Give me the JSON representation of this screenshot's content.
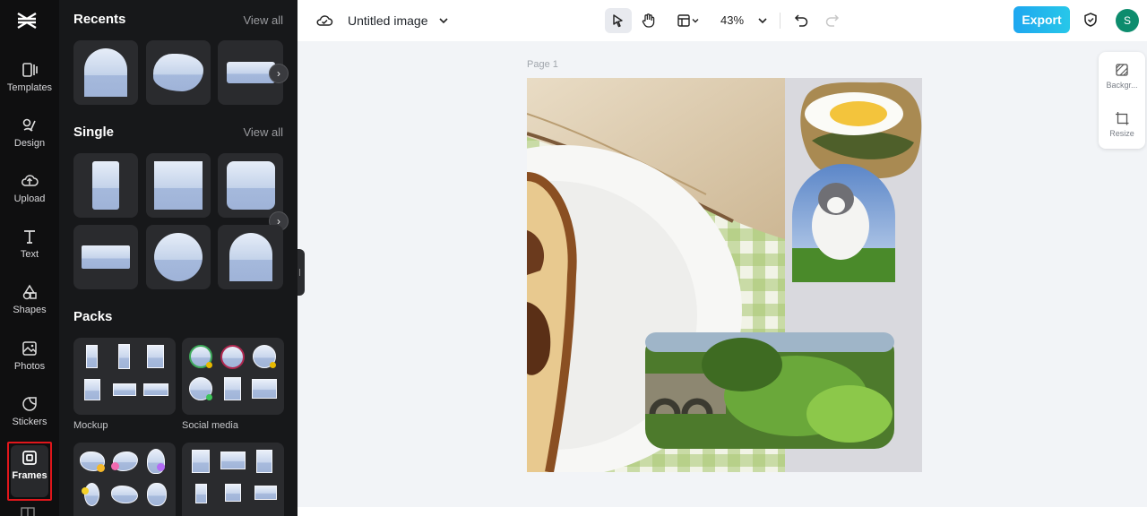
{
  "rail": {
    "items": [
      {
        "label": "Templates"
      },
      {
        "label": "Design"
      },
      {
        "label": "Upload"
      },
      {
        "label": "Text"
      },
      {
        "label": "Shapes"
      },
      {
        "label": "Photos"
      },
      {
        "label": "Stickers"
      },
      {
        "label": "Frames"
      }
    ],
    "active": "Frames"
  },
  "panel": {
    "recents_title": "Recents",
    "recents_view_all": "View all",
    "single_title": "Single",
    "single_view_all": "View all",
    "packs_title": "Packs",
    "packs": [
      {
        "label": "Mockup"
      },
      {
        "label": "Social media"
      }
    ]
  },
  "topbar": {
    "title": "Untitled image",
    "zoom": "43%",
    "export_label": "Export",
    "avatar_initial": "S"
  },
  "canvas": {
    "page_label": "Page 1"
  },
  "float_panel": {
    "background_label": "Backgr...",
    "resize_label": "Resize"
  },
  "colors": {
    "accent": "#1ea7f0",
    "active_outline": "#e0161b",
    "avatar": "#0d8c6d"
  }
}
